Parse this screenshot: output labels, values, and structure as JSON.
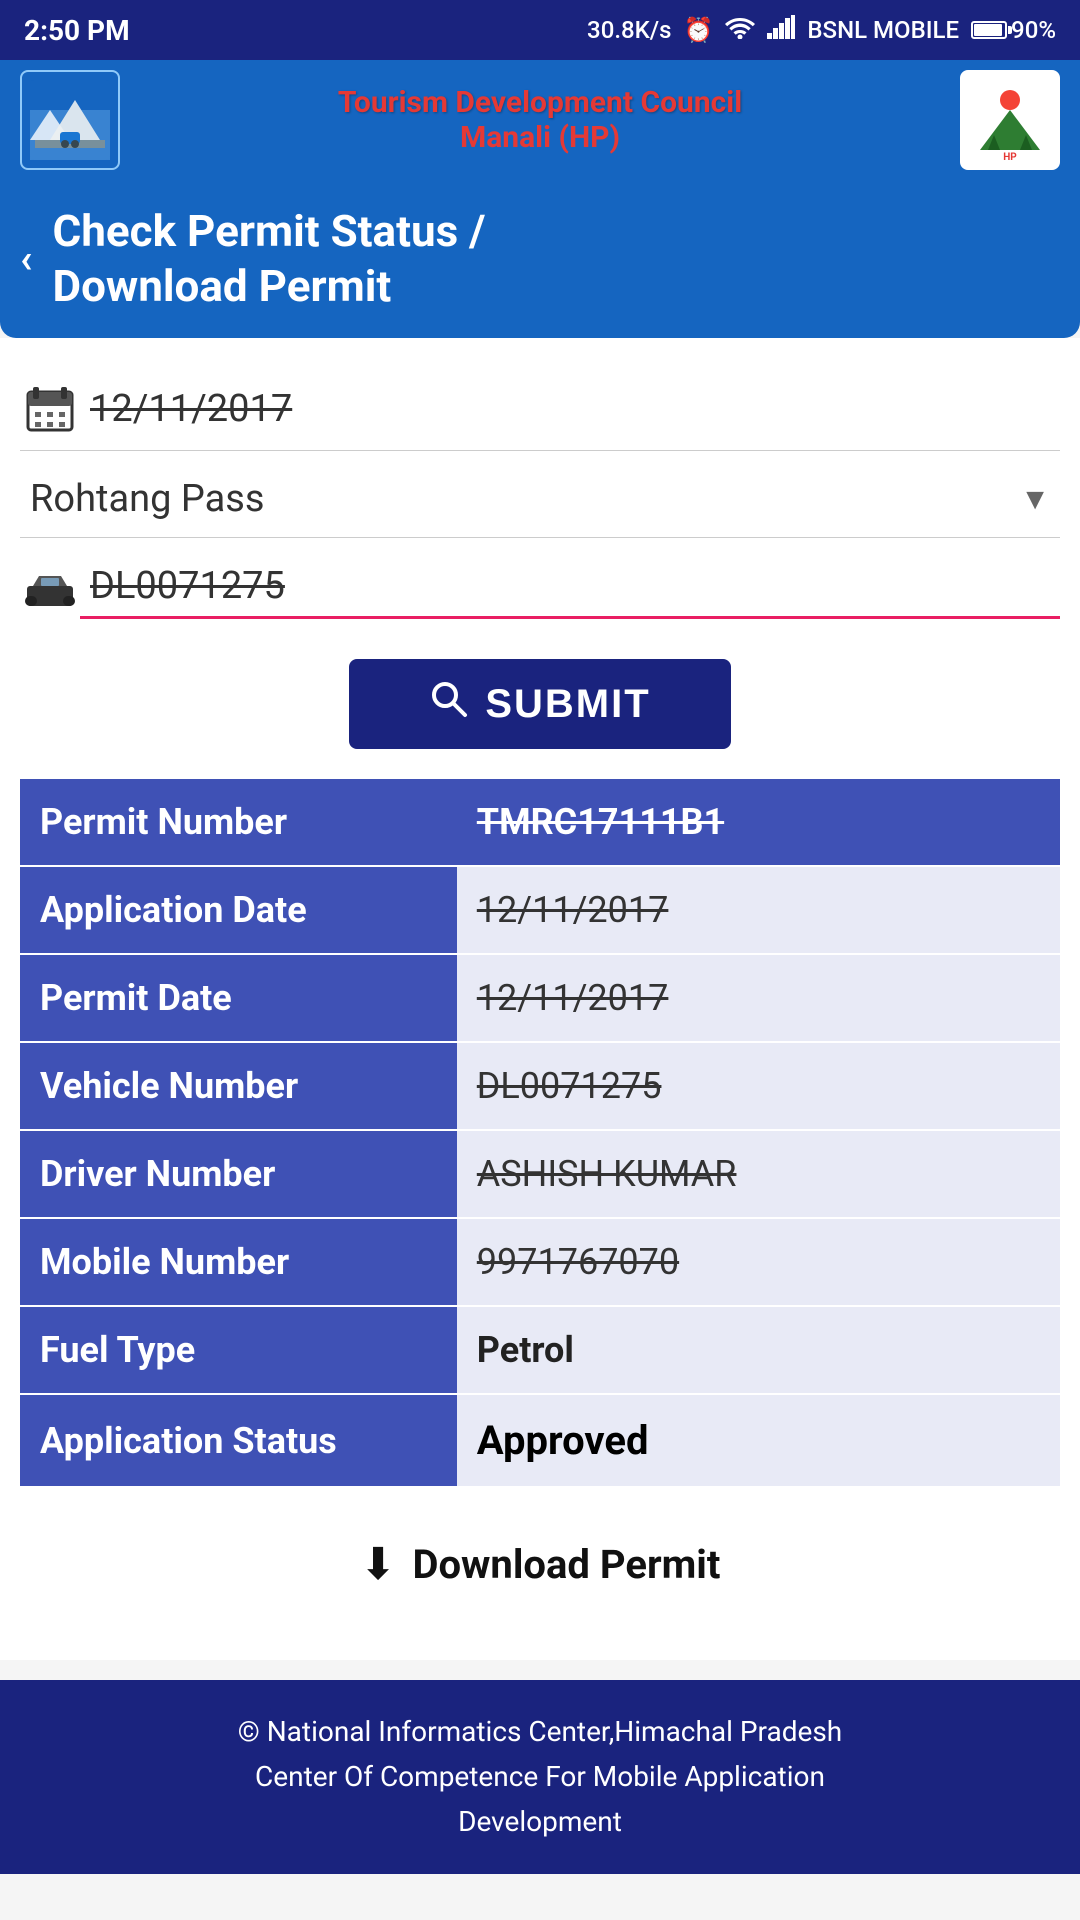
{
  "statusBar": {
    "time": "2:50 PM",
    "network": "30.8K/s",
    "carrier": "BSNL MOBILE",
    "battery": "90%"
  },
  "header": {
    "titleLine1": "Tourism Development Council",
    "titleLine2": "Manali (HP)",
    "logoAlt": "Himachal Tourism"
  },
  "pageTitleBar": {
    "backLabel": "‹",
    "title": "Check Permit Status /\nDownload Permit"
  },
  "form": {
    "dateValue": "12/11/2017",
    "destinationLabel": "Rohtang Pass",
    "vehicleNumber": "DL0071275",
    "submitLabel": "SUBMIT"
  },
  "results": {
    "permitNumberLabel": "Permit Number",
    "permitNumberValue": "TMRC17111B1",
    "applicationDateLabel": "Application Date",
    "applicationDateValue": "12/11/2017",
    "permitDateLabel": "Permit Date",
    "permitDateValue": "12/11/2017",
    "vehicleNumberLabel": "Vehicle Number",
    "vehicleNumberValue": "DL0071275",
    "driverNumberLabel": "Driver Number",
    "driverNumberValue": "ASHISH KUMAR",
    "mobileNumberLabel": "Mobile Number",
    "mobileNumberValue": "9971767070",
    "fuelTypeLabel": "Fuel Type",
    "fuelTypeValue": "Petrol",
    "applicationStatusLabel": "Application Status",
    "applicationStatusValue": "Approved"
  },
  "download": {
    "label": "Download Permit"
  },
  "footer": {
    "text": "© National Informatics Center,Himachal Pradesh\nCenter Of Competence For Mobile Application\nDevelopment"
  }
}
